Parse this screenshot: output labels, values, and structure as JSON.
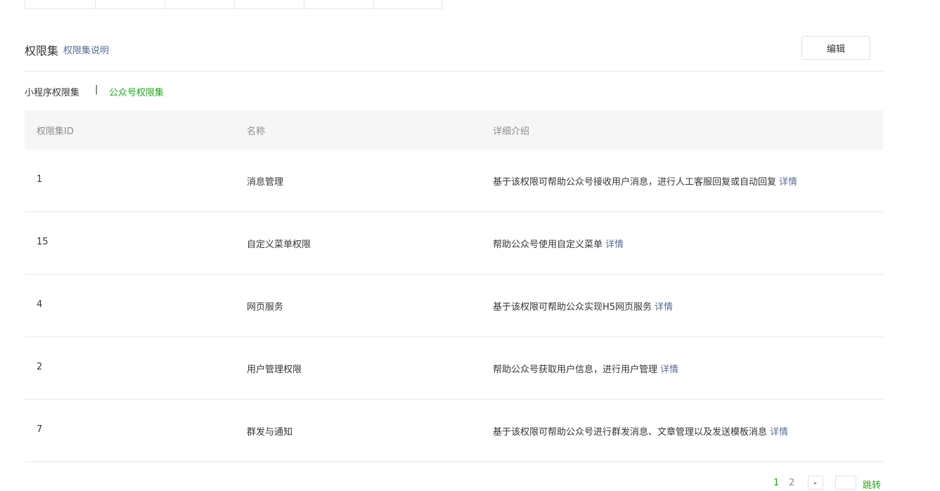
{
  "section": {
    "title": "权限集",
    "help_link": "权限集说明",
    "edit_label": "编辑"
  },
  "tabs": [
    {
      "label": "小程序权限集",
      "active": false
    },
    {
      "label": "公众号权限集",
      "active": true
    }
  ],
  "tab_separator": "|",
  "table": {
    "headers": {
      "id": "权限集ID",
      "name": "名称",
      "desc": "详细介绍"
    },
    "detail_label": "详情",
    "rows": [
      {
        "id": "1",
        "name": "消息管理",
        "desc": "基于该权限可帮助公众号接收用户消息，进行人工客服回复或自动回复"
      },
      {
        "id": "15",
        "name": "自定义菜单权限",
        "desc": "帮助公众号使用自定义菜单"
      },
      {
        "id": "4",
        "name": "网页服务",
        "desc": "基于该权限可帮助公众实现H5网页服务"
      },
      {
        "id": "2",
        "name": "用户管理权限",
        "desc": "帮助公众号获取用户信息，进行用户管理"
      },
      {
        "id": "7",
        "name": "群发与通知",
        "desc": "基于该权限可帮助公众号进行群发消息、文章管理以及发送模板消息"
      }
    ]
  },
  "pagination": {
    "pages": [
      "1",
      "2"
    ],
    "current": "1",
    "next_icon": "▸",
    "jump_label": "跳转",
    "jump_value": ""
  },
  "colors": {
    "accent": "#1aad19",
    "link": "#576b95"
  }
}
